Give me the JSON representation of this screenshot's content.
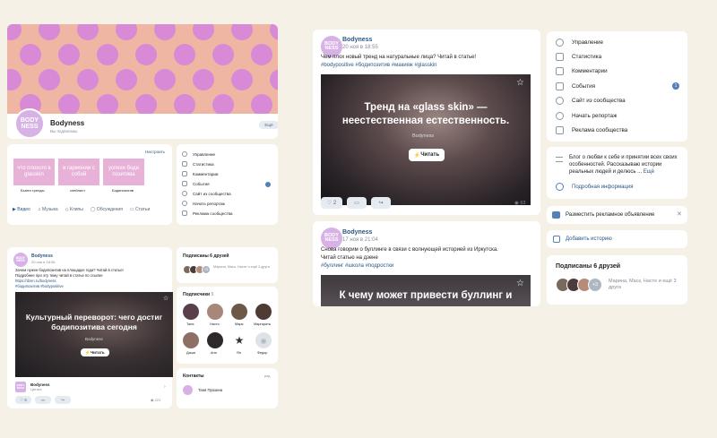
{
  "brand": {
    "name": "Bodyness",
    "logo_text": "BODY\nNESS",
    "status_small": "Вы подписаны",
    "subscribe_btn": "Ещё"
  },
  "colors": {
    "cover_bg": "#efb7a3",
    "cover_dot": "#d88ad6",
    "brand_avatar": "#d7b2e6",
    "accent": "#2a5885"
  },
  "left_profile": {
    "settings_link": "Настроить",
    "stories": [
      {
        "text": "что плохого в glasskin",
        "label": "Бьюти тренды"
      },
      {
        "text": "в гармонии с собой",
        "label": "спейлист"
      },
      {
        "text": "успехи боди позитива",
        "label": "Бодипозитив"
      }
    ],
    "tabs": [
      "Видео",
      "Музыка",
      "Клипы",
      "Обсуждения",
      "Статьи"
    ],
    "menu": [
      "Управление",
      "Статистика",
      "Комментарии",
      "События",
      "Сайт из сообщества",
      "Начать репортаж",
      "Реклама сообщества"
    ]
  },
  "left_post": {
    "author": "Bodyness",
    "date": "20 ноя в 18:55",
    "text1": "Зачем нужен бодипозитив на площадке года? Читай в статье!",
    "text2": "Подробнее про эту тему читай в статье по ссылке",
    "link": "https://dzen.ru/bodyness",
    "tags": "#бодипозитив #bodypositive",
    "image_title": "Культурный переворот: чего достиг бодипозитива сегодня",
    "image_brand": "Bodyness",
    "read_btn": "Читать",
    "foot_name": "Bodyness",
    "foot_sub": "Цитата",
    "likes": "6",
    "views": "221"
  },
  "left_friends": {
    "title": "Подписаны 6 друзей",
    "plus": "+3",
    "names": "Марина, Маск, Насте и ещё 3 друга"
  },
  "left_subs": {
    "title": "Подписчики",
    "count": "9",
    "people": [
      "Таня",
      "Настя",
      "Маря",
      "Маргарита",
      "Даша",
      "Аня",
      "Ян",
      "Федор"
    ]
  },
  "left_contacts": {
    "title": "Контакты",
    "edit": "ред.",
    "name": "Таня Прохина"
  },
  "post1": {
    "author": "Bodyness",
    "date": "20 ноя в 18:55",
    "text": "Чем плох новый тренд на натуральные лица? Читай в статье!",
    "tags": "#bodypositive #бодипозитив #макияж #glasskin",
    "image_title": "Тренд на «glass skin» — неестественная естественность.",
    "image_brand": "Bodyness",
    "read_btn": "Читать",
    "likes": "2",
    "views": "63"
  },
  "post2": {
    "author": "Bodyness",
    "date": "17 ноя в 21:04",
    "text1": "Снова говорим о буллинге в связи с волнующей историей из Иркутска.",
    "text2": "Читай статью на дзене",
    "tags": "#буллинг #школа #подростки",
    "image_title": "К чему может привести буллинг и"
  },
  "right_menu": {
    "items": [
      "Управление",
      "Статистика",
      "Комментарии",
      "События",
      "Сайт из сообщества",
      "Начать репортаж",
      "Реклама сообщества"
    ],
    "events_badge": "1"
  },
  "right_about": {
    "text": "Блог о любви к себе и принятии всех своих особенностей. Рассказываю истории реальных людей и делюсь ...",
    "more": "Ещё",
    "info_link": "Подробная информация"
  },
  "right_ad": {
    "label": "Разместить рекламное объявление"
  },
  "right_story": {
    "label": "Добавить историю"
  },
  "right_friends": {
    "title": "Подписаны 6 друзей",
    "plus": "+3",
    "names": "Марина, Маск, Насте и ещё 3 друга"
  }
}
